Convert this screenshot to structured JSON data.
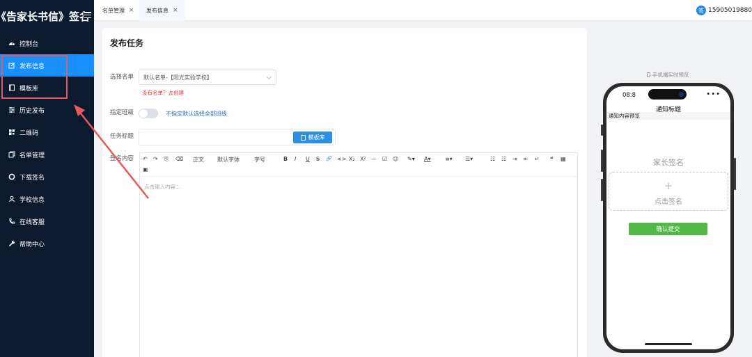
{
  "sidebar": {
    "brand": "《告家长书信》签名",
    "items": [
      {
        "label": "控制台",
        "icon": "dashboard-icon"
      },
      {
        "label": "发布信息",
        "icon": "edit-icon",
        "active": true
      },
      {
        "label": "模板库",
        "icon": "book-icon"
      },
      {
        "label": "历史发布",
        "icon": "sliders-icon"
      },
      {
        "label": "二维码",
        "icon": "qrcode-icon"
      },
      {
        "label": "名单管理",
        "icon": "copy-icon"
      },
      {
        "label": "下载签名",
        "icon": "circle-icon"
      },
      {
        "label": "学校信息",
        "icon": "user-icon"
      },
      {
        "label": "在线客服",
        "icon": "phone-icon"
      },
      {
        "label": "帮助中心",
        "icon": "wrench-icon"
      }
    ]
  },
  "tabs": [
    {
      "label": "名单管理",
      "close": "×"
    },
    {
      "label": "发布信息",
      "close": "×",
      "active": true
    }
  ],
  "user": {
    "phone": "15905019880",
    "avatar_text": "签"
  },
  "form": {
    "title": "发布任务",
    "list_label": "选择名单",
    "list_value": "默认名单-【阳光实验学校】",
    "no_list_hint": "没有名单？去创建",
    "class_label": "指定班级",
    "class_toggle_text": "不指定默认选择全部班级",
    "task_title_label": "任务标题",
    "template_button": "模板库",
    "content_label": "签名内容",
    "editor_placeholder": "点击输入内容..."
  },
  "toolbar": {
    "undo": "↶",
    "redo": "↷",
    "format_painter": "⎘",
    "clear": "⌫",
    "paragraph": "正文",
    "font_family": "默认字体",
    "font_size": "字号",
    "bold": "B",
    "italic": "I",
    "underline": "U",
    "strike": "S",
    "link": "🔗",
    "code": "<>",
    "subscript": "X₂",
    "superscript": "X²",
    "hr": "—",
    "todo": "☑",
    "emoji": "☺",
    "quote": "❝",
    "table": "▦",
    "image": "▣"
  },
  "preview": {
    "label": "手机端实时预览",
    "time": "08:8",
    "dots": "•••",
    "page_title": "通知标题",
    "content_preview": "通知内容预览",
    "sig_title": "家长签名",
    "sig_plus": "+",
    "sig_text": "点击签名",
    "confirm": "确认提交"
  },
  "colors": {
    "sidebar_bg": "#0b1a2e",
    "active_blue": "#1890ff",
    "confirm_green": "#52b848",
    "highlight_red": "#e35b5b"
  }
}
